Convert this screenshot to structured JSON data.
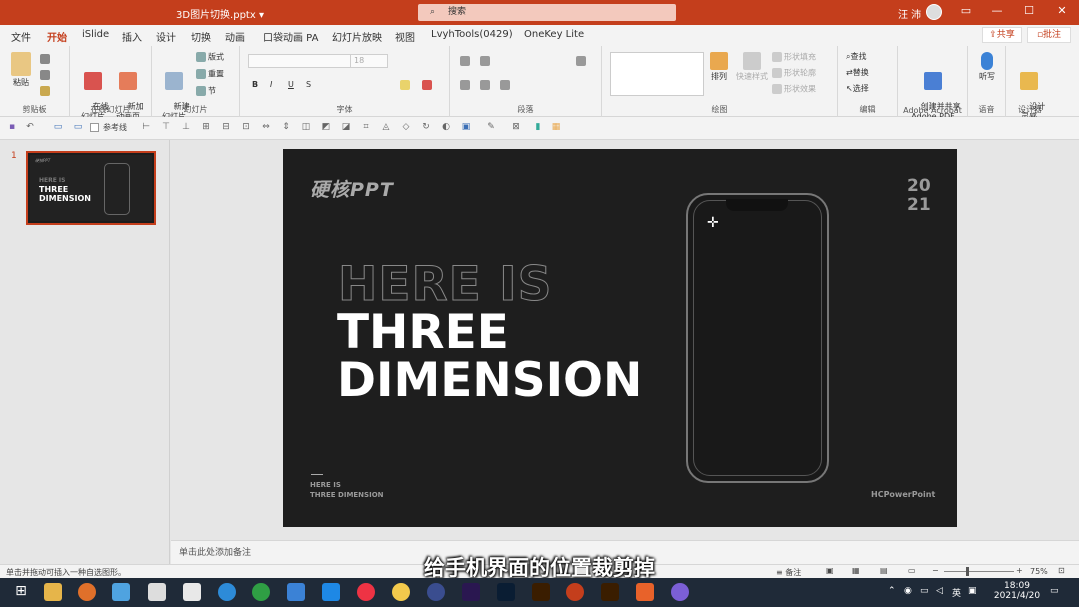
{
  "titlebar": {
    "doc_title": "3D图片切换.pptx ▾",
    "search_placeholder": "搜索",
    "user": "汪 沛",
    "minimize": "—",
    "maximize": "☐",
    "close": "✕",
    "ribbon_display": "▭"
  },
  "tabs": [
    "文件",
    "开始",
    "iSlide",
    "插入",
    "设计",
    "切换",
    "动画",
    "口袋动画 PA",
    "幻灯片放映",
    "视图",
    "LvyhTools(0429)",
    "OneKey Lite"
  ],
  "share_label": "共享",
  "comment_label": "批注",
  "ribbon": {
    "clipboard": {
      "paste": "粘贴",
      "label": "剪贴板"
    },
    "online": {
      "btn1": "在线\n幻灯片",
      "btn2": "新加\n动画页",
      "label": "在线幻灯片"
    },
    "slides": {
      "new": "新建\n幻灯片",
      "layout": "版式",
      "reset": "重置",
      "section": "节",
      "label": "幻灯片"
    },
    "font": {
      "font_name": "",
      "font_size": "18",
      "bold": "B",
      "italic": "I",
      "underline": "U",
      "strike": "S",
      "label": "字体"
    },
    "paragraph": {
      "label": "段落"
    },
    "drawing": {
      "arrange": "排列",
      "quick_styles": "快速样式",
      "fill": "形状填充",
      "outline": "形状轮廓",
      "effects": "形状效果",
      "label": "绘图"
    },
    "editing": {
      "find": "查找",
      "replace": "替换",
      "select": "选择",
      "label": "编辑"
    },
    "acrobat": {
      "create": "创建并共享\nAdobe PDF",
      "label": "Adobe Acrobat"
    },
    "voice": {
      "dictate": "听写",
      "label": "语音"
    },
    "designer": {
      "ideas": "设计\n灵感",
      "label": "设计器"
    }
  },
  "qat": {
    "gridlines": "参考线"
  },
  "thumbnail": {
    "number": "1"
  },
  "slide": {
    "logo": "硬核PPT",
    "year_top": "20",
    "year_bottom": "21",
    "outline_title": "HERE IS",
    "title_line1": "THREE",
    "title_line2": "DIMENSION",
    "small_line1": "HERE IS",
    "small_line2": "THREE DIMENSION",
    "brand": "HCPowerPoint"
  },
  "notes_placeholder": "单击此处添加备注",
  "status": {
    "left": "单击并拖动可插入一种自选图形。",
    "notes": "备注",
    "zoom": "75%"
  },
  "caption": "给手机界面的位置裁剪掉",
  "taskbar": {
    "ime": "英",
    "time": "18:09",
    "date": "2021/4/20"
  }
}
